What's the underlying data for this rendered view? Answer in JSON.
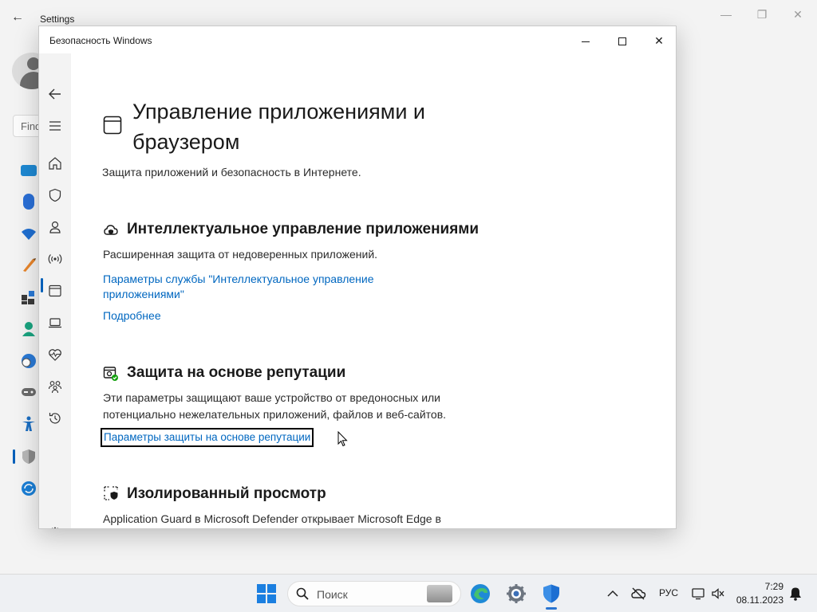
{
  "background_window": {
    "title": "Settings",
    "search_placeholder": "Find"
  },
  "security_window": {
    "title": "Безопасность Windows"
  },
  "page": {
    "title": "Управление приложениями и браузером",
    "subtitle": "Защита приложений и безопасность в Интернете."
  },
  "sections": {
    "smart_app": {
      "heading": "Интеллектуальное управление приложениями",
      "description": "Расширенная защита от недоверенных приложений.",
      "settings_link": "Параметры службы \"Интеллектуальное управление приложениями\"",
      "more_link": "Подробнее"
    },
    "reputation": {
      "heading": "Защита на основе репутации",
      "description": "Эти параметры защищают ваше устройство от вредоносных или потенциально нежелательных приложений, файлов и веб-сайтов.",
      "settings_link": "Параметры защиты на основе репутации"
    },
    "isolated": {
      "heading": "Изолированный просмотр",
      "description": "Application Guard в Microsoft Defender открывает Microsoft Edge в изолированной среде просмотра, чтобы лучше защитить ваше устройство и данные от вредоносных программ."
    }
  },
  "taskbar": {
    "search_placeholder": "Поиск",
    "language": "РУС",
    "time": "7:29",
    "date": "08.11.2023"
  },
  "colors": {
    "accent": "#005fb8",
    "link": "#0067c0"
  }
}
